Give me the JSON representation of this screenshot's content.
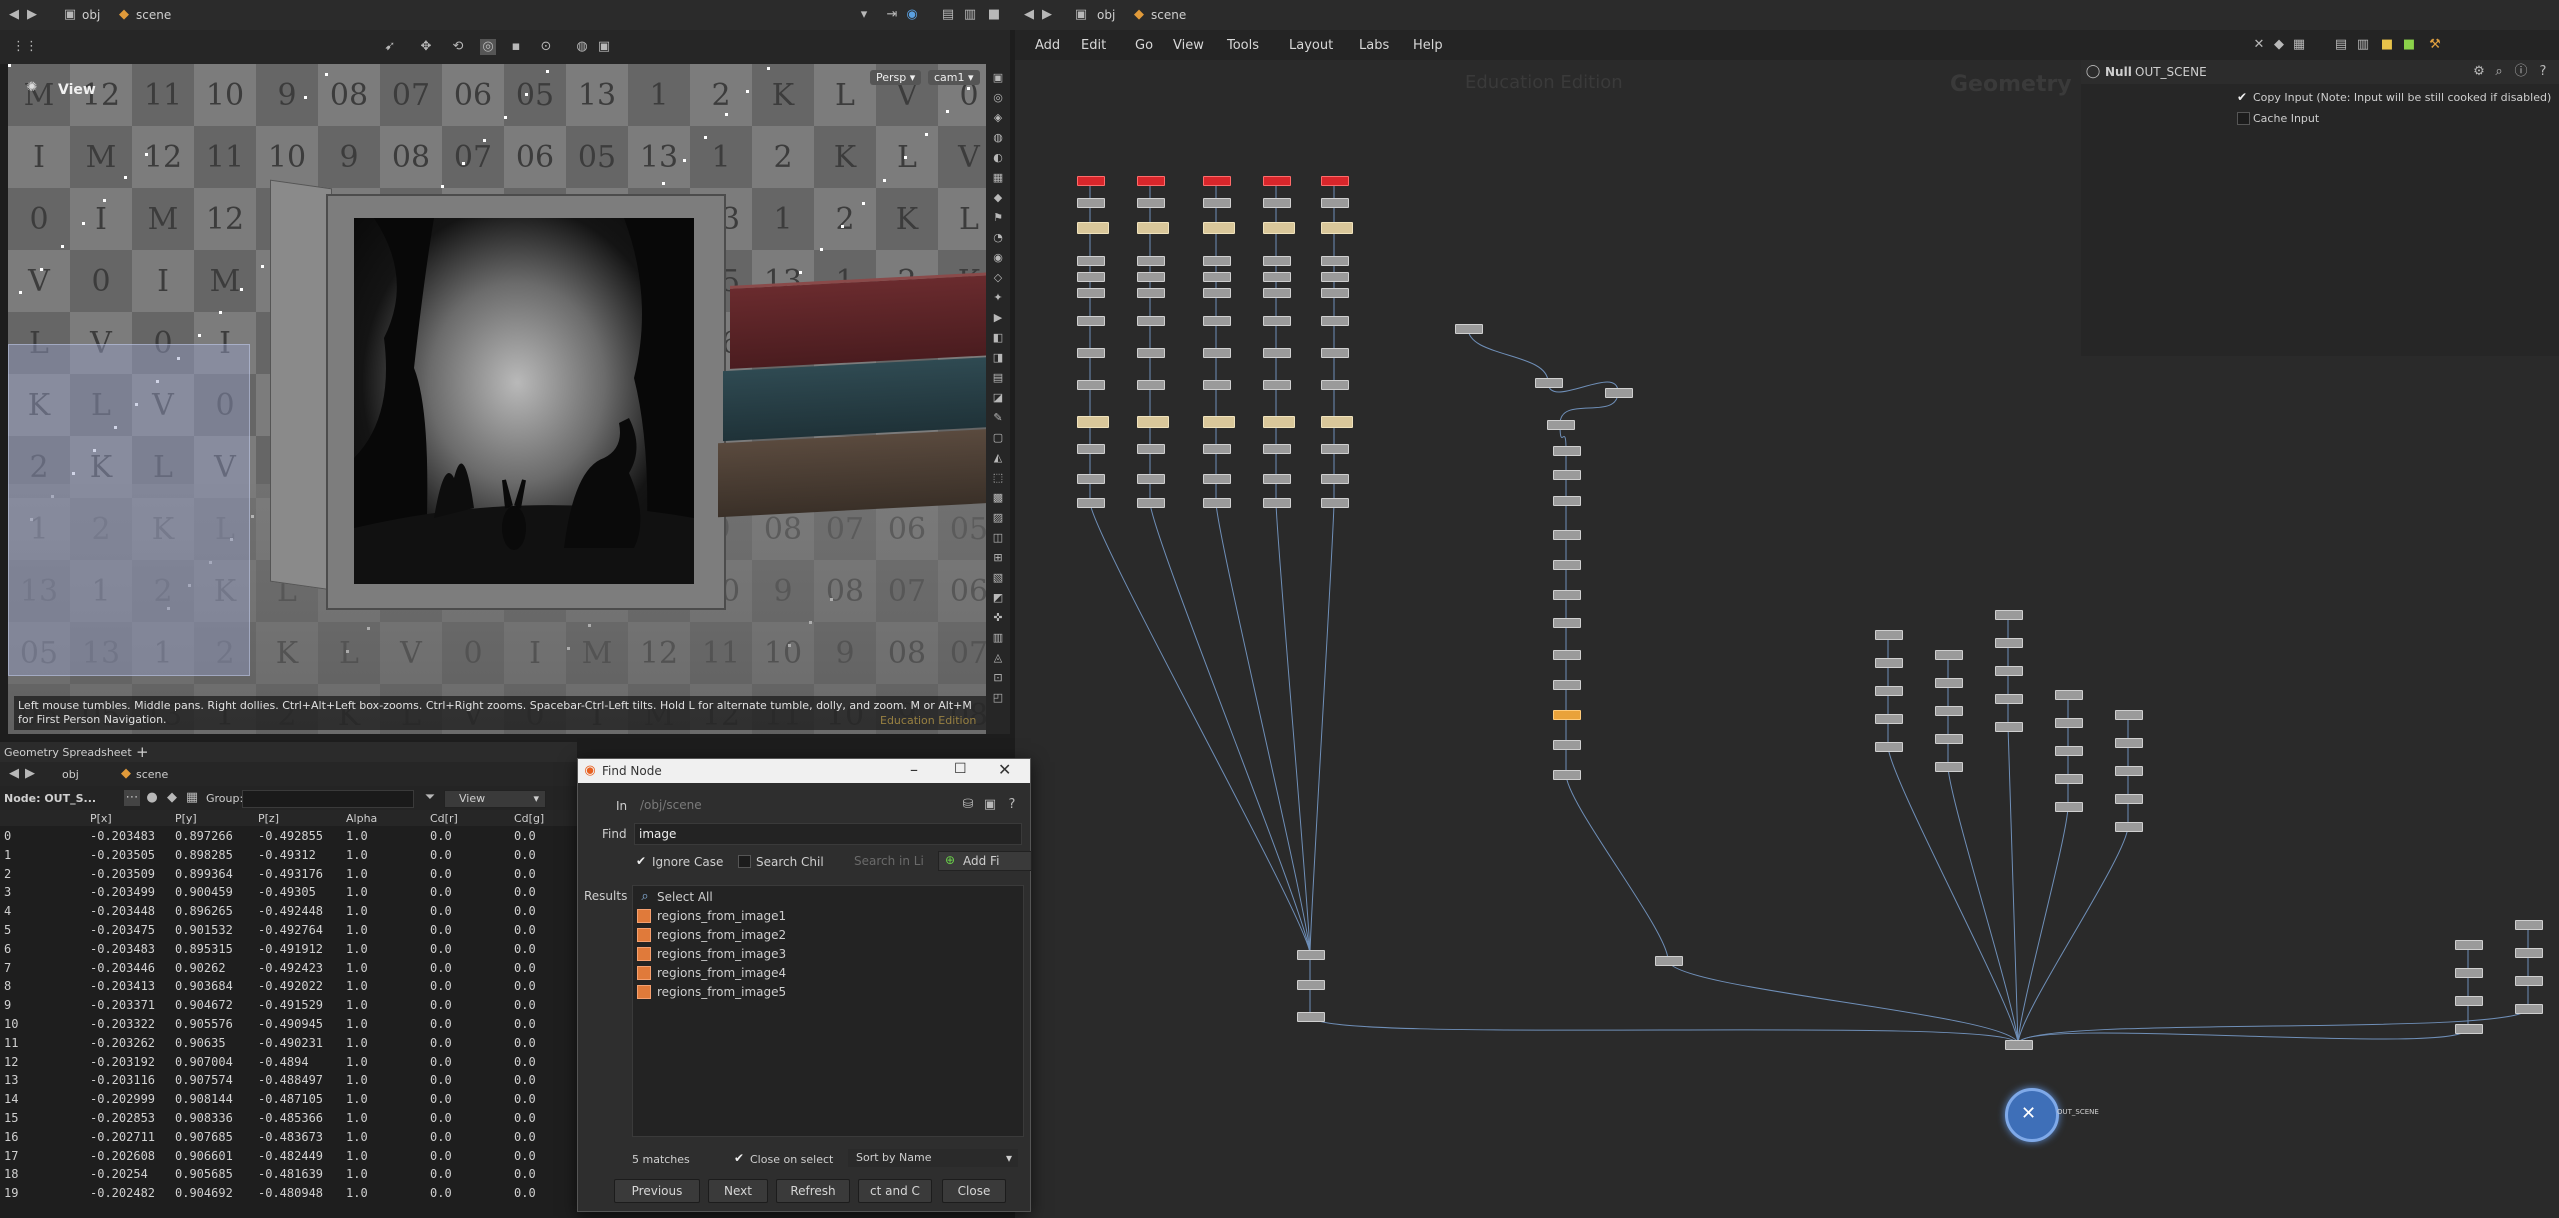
{
  "left_path": {
    "root": "obj",
    "current": "scene"
  },
  "right_path": {
    "root": "obj",
    "current": "scene"
  },
  "viewport": {
    "title": "View",
    "camera_mode": "Persp",
    "camera": "cam1",
    "hint": "Left mouse tumbles. Middle pans. Right dollies. Ctrl+Alt+Left box-zooms. Ctrl+Right zooms. Spacebar-Ctrl-Left tilts. Hold L for alternate tumble, dolly, and zoom. M or Alt+M for First Person Navigation.",
    "watermark": "Education Edition"
  },
  "spreadsheet": {
    "tab": "Geometry Spreadsheet",
    "node_label": "Node: OUT_S...",
    "group_label": "Group:",
    "view_label": "View",
    "columns": [
      "P[x]",
      "P[y]",
      "P[z]",
      "Alpha",
      "Cd[r]",
      "Cd[g]"
    ],
    "rows": [
      [
        "0",
        "-0.203483",
        "0.897266",
        "-0.492855",
        "1.0",
        "0.0",
        "0.0"
      ],
      [
        "1",
        "-0.203505",
        "0.898285",
        "-0.49312",
        "1.0",
        "0.0",
        "0.0"
      ],
      [
        "2",
        "-0.203509",
        "0.899364",
        "-0.493176",
        "1.0",
        "0.0",
        "0.0"
      ],
      [
        "3",
        "-0.203499",
        "0.900459",
        "-0.49305",
        "1.0",
        "0.0",
        "0.0"
      ],
      [
        "4",
        "-0.203448",
        "0.896265",
        "-0.492448",
        "1.0",
        "0.0",
        "0.0"
      ],
      [
        "5",
        "-0.203475",
        "0.901532",
        "-0.492764",
        "1.0",
        "0.0",
        "0.0"
      ],
      [
        "6",
        "-0.203483",
        "0.895315",
        "-0.491912",
        "1.0",
        "0.0",
        "0.0"
      ],
      [
        "7",
        "-0.203446",
        "0.90262",
        "-0.492423",
        "1.0",
        "0.0",
        "0.0"
      ],
      [
        "8",
        "-0.203413",
        "0.903684",
        "-0.492022",
        "1.0",
        "0.0",
        "0.0"
      ],
      [
        "9",
        "-0.203371",
        "0.904672",
        "-0.491529",
        "1.0",
        "0.0",
        "0.0"
      ],
      [
        "10",
        "-0.203322",
        "0.905576",
        "-0.490945",
        "1.0",
        "0.0",
        "0.0"
      ],
      [
        "11",
        "-0.203262",
        "0.90635",
        "-0.490231",
        "1.0",
        "0.0",
        "0.0"
      ],
      [
        "12",
        "-0.203192",
        "0.907004",
        "-0.4894",
        "1.0",
        "0.0",
        "0.0"
      ],
      [
        "13",
        "-0.203116",
        "0.907574",
        "-0.488497",
        "1.0",
        "0.0",
        "0.0"
      ],
      [
        "14",
        "-0.202999",
        "0.908144",
        "-0.487105",
        "1.0",
        "0.0",
        "0.0"
      ],
      [
        "15",
        "-0.202853",
        "0.908336",
        "-0.485366",
        "1.0",
        "0.0",
        "0.0"
      ],
      [
        "16",
        "-0.202711",
        "0.907685",
        "-0.483673",
        "1.0",
        "0.0",
        "0.0"
      ],
      [
        "17",
        "-0.202608",
        "0.906601",
        "-0.482449",
        "1.0",
        "0.0",
        "0.0"
      ],
      [
        "18",
        "-0.20254",
        "0.905685",
        "-0.481639",
        "1.0",
        "0.0",
        "0.0"
      ],
      [
        "19",
        "-0.202482",
        "0.904692",
        "-0.480948",
        "1.0",
        "0.0",
        "0.0"
      ]
    ]
  },
  "find_node": {
    "title": "Find Node",
    "in_label": "In",
    "in_value": "/obj/scene",
    "find_label": "Find",
    "find_value": "image",
    "ignore_case": "Ignore Case",
    "search_children": "Search Chil",
    "search_in_placeholder": "Search in Li",
    "add_filter": "Add Fi",
    "results_label": "Results",
    "select_all": "Select All",
    "results": [
      "regions_from_image1",
      "regions_from_image2",
      "regions_from_image3",
      "regions_from_image4",
      "regions_from_image5"
    ],
    "matches": "5 matches",
    "close_on_select": "Close on select",
    "sort": "Sort by Name",
    "buttons": {
      "previous": "Previous",
      "next": "Next",
      "refresh": "Refresh",
      "select_and_close": "ct and C",
      "close": "Close"
    }
  },
  "network": {
    "menu": [
      "Add",
      "Edit",
      "Go",
      "View",
      "Tools",
      "Layout",
      "Labs",
      "Help"
    ],
    "watermark": "Education Edition",
    "context_label": "Geometry"
  },
  "params": {
    "node_type": "Null",
    "node_name": "OUT_SCENE",
    "copy_input": "Copy Input (Note: Input will be still cooked if disabled)",
    "cache_input": "Cache Input"
  },
  "output_node_label": "OUT_SCENE"
}
